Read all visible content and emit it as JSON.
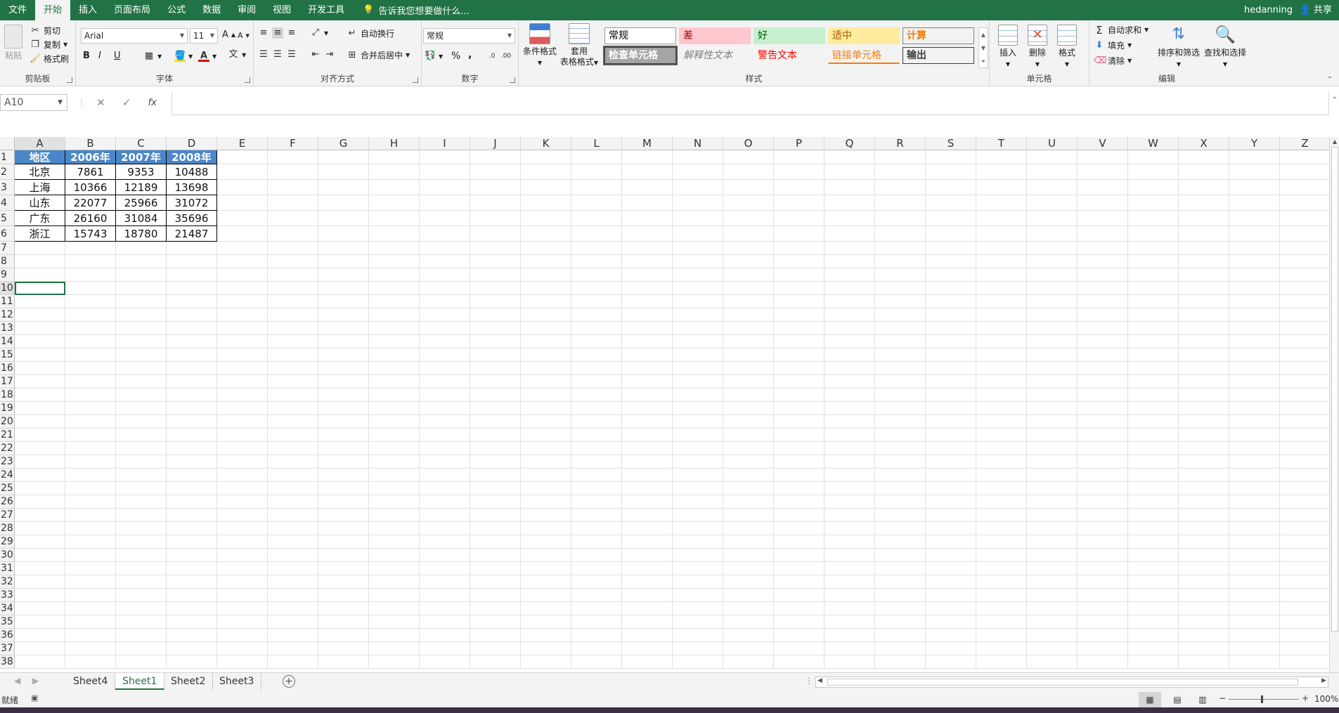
{
  "menu": {
    "tabs": [
      "文件",
      "开始",
      "插入",
      "页面布局",
      "公式",
      "数据",
      "审阅",
      "视图",
      "开发工具"
    ],
    "active_index": 1,
    "tell_me": "告诉我您想要做什么...",
    "user": "hedanning",
    "share": "共享"
  },
  "ribbon": {
    "clipboard": {
      "paste": "粘贴",
      "cut": "剪切",
      "copy": "复制",
      "format_painter": "格式刷",
      "label": "剪贴板"
    },
    "font": {
      "name": "Arial",
      "size": "11",
      "bold": "B",
      "italic": "I",
      "underline": "U",
      "label": "字体",
      "grow": "A",
      "shrink": "A"
    },
    "alignment": {
      "wrap": "自动换行",
      "merge": "合并后居中",
      "label": "对齐方式"
    },
    "number": {
      "format": "常规",
      "percent": "%",
      "comma": ",",
      "label": "数字"
    },
    "styles": {
      "cond_format": "条件格式",
      "table_format_1": "套用",
      "table_format_2": "表格格式",
      "label": "样式",
      "cells": [
        {
          "text": "常规",
          "bg": "#ffffff",
          "fg": "#000000",
          "border": "#9b9b9b"
        },
        {
          "text": "差",
          "bg": "#ffc7ce",
          "fg": "#9c0006",
          "border": "#ffc7ce"
        },
        {
          "text": "好",
          "bg": "#c6efce",
          "fg": "#006100",
          "border": "#c6efce"
        },
        {
          "text": "适中",
          "bg": "#ffeb9c",
          "fg": "#9c5700",
          "border": "#ffeb9c"
        },
        {
          "text": "计算",
          "bg": "#f2f2f2",
          "fg": "#fa7d00",
          "border": "#7f7f7f"
        },
        {
          "text": "检查单元格",
          "bg": "#a5a5a5",
          "fg": "#ffffff",
          "border": "#3f3f3f"
        },
        {
          "text": "解释性文本",
          "bg": "#f3f3f3",
          "fg": "#7f7f7f",
          "border": "#f3f3f3"
        },
        {
          "text": "警告文本",
          "bg": "#f3f3f3",
          "fg": "#ff0000",
          "border": "#f3f3f3"
        },
        {
          "text": "链接单元格",
          "bg": "#f3f3f3",
          "fg": "#fa7d00",
          "border": "#f3f3f3"
        },
        {
          "text": "输出",
          "bg": "#f2f2f2",
          "fg": "#3f3f3f",
          "border": "#3f3f3f"
        }
      ]
    },
    "cells": {
      "insert": "插入",
      "delete": "删除",
      "format": "格式",
      "label": "单元格"
    },
    "editing": {
      "autosum": "自动求和",
      "fill": "填充",
      "clear": "清除",
      "sort": "排序和筛选",
      "find": "查找和选择",
      "label": "编辑"
    }
  },
  "formula": {
    "name_box": "A10",
    "fx": "fx",
    "cancel": "✕",
    "enter": "✓",
    "value": ""
  },
  "grid": {
    "columns": [
      "A",
      "B",
      "C",
      "D",
      "E",
      "F",
      "G",
      "H",
      "I",
      "J",
      "K",
      "L",
      "M",
      "N",
      "O",
      "P",
      "Q",
      "R",
      "S",
      "T",
      "U",
      "V",
      "W",
      "X",
      "Y",
      "Z"
    ],
    "rows": [
      "1",
      "2",
      "3",
      "4",
      "5",
      "6",
      "7",
      "8",
      "9",
      "10",
      "11",
      "12",
      "13",
      "14",
      "15",
      "16",
      "17",
      "18",
      "19",
      "20",
      "21",
      "22",
      "23",
      "24",
      "25",
      "26",
      "27",
      "28",
      "29",
      "30",
      "31",
      "32",
      "33",
      "34",
      "35",
      "36",
      "37",
      "38"
    ],
    "header": [
      "地区",
      "2006年",
      "2007年",
      "2008年"
    ],
    "data": [
      [
        "北京",
        "7861",
        "9353",
        "10488"
      ],
      [
        "上海",
        "10366",
        "12189",
        "13698"
      ],
      [
        "山东",
        "22077",
        "25966",
        "31072"
      ],
      [
        "广东",
        "26160",
        "31084",
        "35696"
      ],
      [
        "浙江",
        "15743",
        "18780",
        "21487"
      ]
    ],
    "header_color": "#4a86c8"
  },
  "sheets": {
    "tabs": [
      "Sheet4",
      "Sheet1",
      "Sheet2",
      "Sheet3"
    ],
    "active_index": 1
  },
  "status": {
    "ready": "就绪",
    "zoom": "100%"
  }
}
